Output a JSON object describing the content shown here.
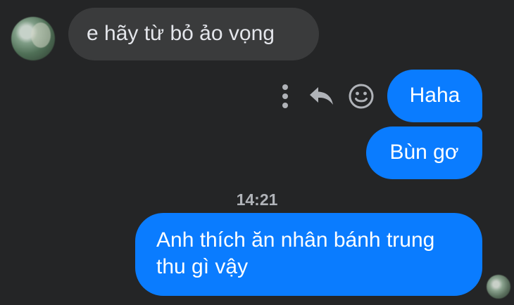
{
  "conversation": {
    "messages": [
      {
        "sender": "contact",
        "text": "e hãy từ bỏ ảo vọng"
      },
      {
        "sender": "me",
        "text": "Haha"
      },
      {
        "sender": "me",
        "text": "Bùn gơ"
      },
      {
        "sender": "me",
        "text": "Anh thích ăn nhân bánh trung thu gì vậy"
      }
    ],
    "timestamp": "14:21"
  },
  "actions": {
    "more_icon": "more-vertical-icon",
    "reply_icon": "reply-icon",
    "react_icon": "smile-icon"
  },
  "colors": {
    "background": "#242526",
    "incoming_bubble": "#3a3b3c",
    "outgoing_bubble": "#0a7cff",
    "timestamp_text": "#b0b3b8",
    "action_icon": "#b0b3b8"
  }
}
